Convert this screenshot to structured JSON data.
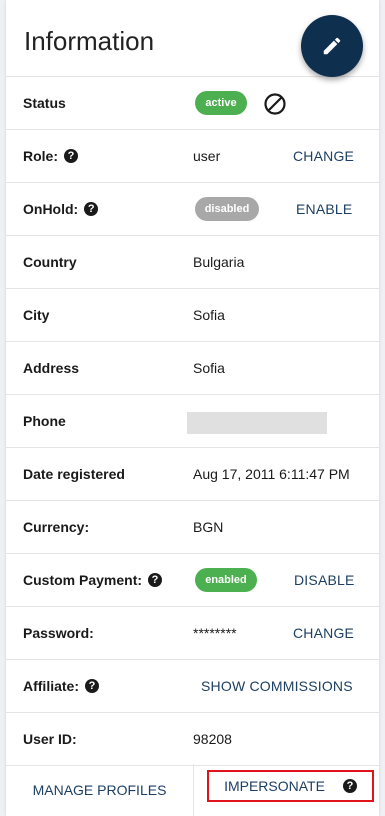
{
  "title": "Information",
  "rows": {
    "status": {
      "label": "Status",
      "badge": "active"
    },
    "role": {
      "label": "Role:",
      "value": "user",
      "action": "CHANGE"
    },
    "onhold": {
      "label": "OnHold:",
      "badge": "disabled",
      "action": "ENABLE"
    },
    "country": {
      "label": "Country",
      "value": "Bulgaria"
    },
    "city": {
      "label": "City",
      "value": "Sofia"
    },
    "address": {
      "label": "Address",
      "value": "Sofia"
    },
    "phone": {
      "label": "Phone"
    },
    "date_registered": {
      "label": "Date registered",
      "value": "Aug 17, 2011 6:11:47 PM"
    },
    "currency": {
      "label": "Currency:",
      "value": "BGN"
    },
    "custom_payment": {
      "label": "Custom Payment:",
      "badge": "enabled",
      "action": "DISABLE"
    },
    "password": {
      "label": "Password:",
      "value": "********",
      "action": "CHANGE"
    },
    "affiliate": {
      "label": "Affiliate:",
      "action": "SHOW COMMISSIONS"
    },
    "user_id": {
      "label": "User ID:",
      "value": "98208"
    }
  },
  "footer": {
    "manage_profiles": "MANAGE PROFILES",
    "impersonate": "IMPERSONATE"
  },
  "help_glyph": "?",
  "colors": {
    "fab": "#0f2f4e",
    "badge_green": "#4caf50",
    "badge_grey": "#a8a8a8",
    "action_text": "#1d3f63",
    "highlight": "#e0131a"
  }
}
